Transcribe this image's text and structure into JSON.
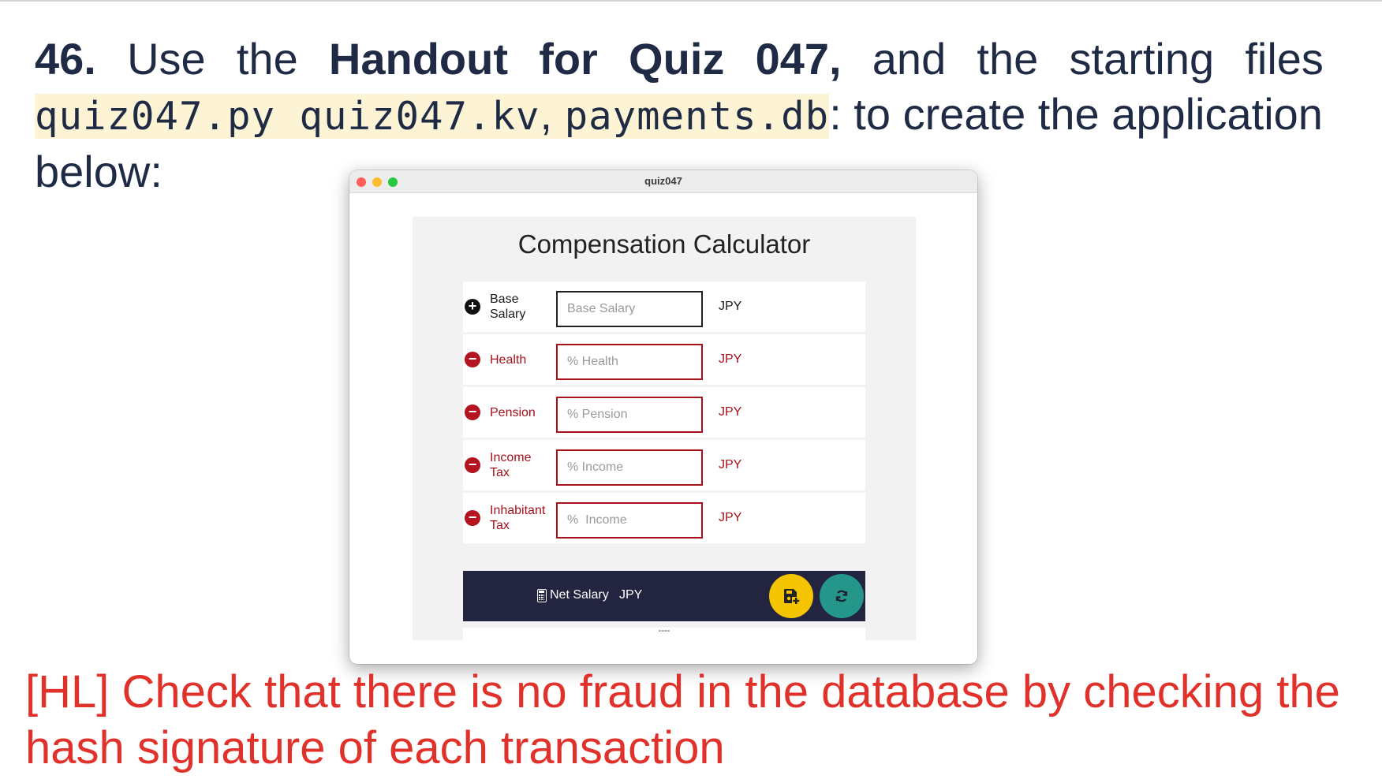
{
  "question": {
    "number": "46.",
    "w_use": "Use",
    "w_the": "the",
    "w_handout": "Handout",
    "w_for": "for",
    "w_quiz": "Quiz",
    "w_quiz_num": "047,",
    "w_and": "and",
    "w_the2": "the",
    "w_starting": "starting",
    "w_files": "files",
    "file1": "quiz047.py",
    "file2": "quiz047.kv",
    "sep": ", ",
    "file3": "payments.db",
    "after_files": ": to create the application",
    "line3": "below:"
  },
  "window": {
    "title": "quiz047",
    "app_title": "Compensation Calculator",
    "rows": [
      {
        "label": "Base Salary",
        "placeholder": "Base Salary",
        "unit": "JPY",
        "icon": "plus-circle-icon"
      },
      {
        "label": "Health",
        "placeholder": "% Health",
        "unit": "JPY",
        "icon": "minus-circle-icon"
      },
      {
        "label": "Pension",
        "placeholder": "% Pension",
        "unit": "JPY",
        "icon": "minus-circle-icon"
      },
      {
        "label": "Income Tax",
        "placeholder": "% Income",
        "unit": "JPY",
        "icon": "minus-circle-icon"
      },
      {
        "label": "Inhabitant Tax",
        "placeholder": "%  Income",
        "unit": "JPY",
        "icon": "minus-circle-icon"
      }
    ],
    "net_label": "Net Salary",
    "net_unit": "JPY",
    "footer_text": "----",
    "colors": {
      "dark_bar": "#222440",
      "save_fab": "#f5c400",
      "refresh_fab": "#24978a",
      "deduction_red": "#a8101c"
    }
  },
  "note": "[HL] Check that there is no fraud in the database by checking the hash signature of each transaction"
}
